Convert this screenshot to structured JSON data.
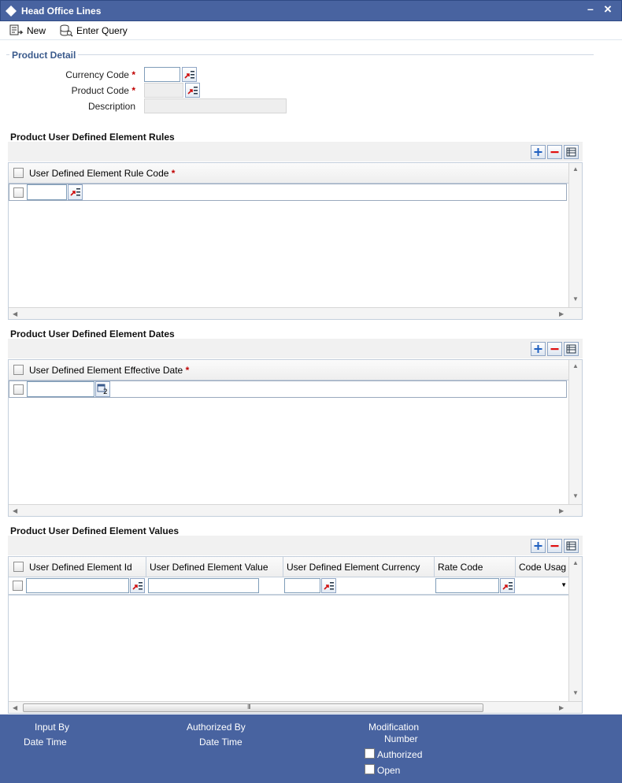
{
  "window": {
    "title": "Head Office Lines"
  },
  "toolbar": {
    "new_label": "New",
    "enter_query_label": "Enter Query"
  },
  "product_detail": {
    "legend": "Product Detail",
    "currency_code_label": "Currency Code",
    "product_code_label": "Product Code",
    "description_label": "Description",
    "required_mark": "*",
    "currency_code_value": "",
    "product_code_value": "",
    "description_value": ""
  },
  "rules_section": {
    "title": "Product User Defined Element Rules",
    "columns": [
      "User Defined Element Rule Code"
    ],
    "required_mark": "*"
  },
  "dates_section": {
    "title": "Product User Defined Element Dates",
    "columns": [
      "User Defined Element Effective Date"
    ],
    "required_mark": "*",
    "date_icon_text": "2"
  },
  "values_section": {
    "title": "Product User Defined Element Values",
    "columns": [
      "User Defined Element Id",
      "User Defined Element Value",
      "User Defined Element Currency",
      "Rate Code",
      "Code Usag"
    ],
    "hscroll_grip": "III"
  },
  "footer": {
    "input_by": "Input By",
    "date_time": "Date Time",
    "authorized_by": "Authorized By",
    "date_time_2": "Date Time",
    "modification": "Modification",
    "number": "Number",
    "authorized": "Authorized",
    "open": "Open"
  },
  "colors": {
    "title_bar": "#4863a0",
    "accent_blue": "#3a5a8c",
    "required": "#c00000",
    "remove_red": "#e01010",
    "add_blue": "#2060c0"
  }
}
